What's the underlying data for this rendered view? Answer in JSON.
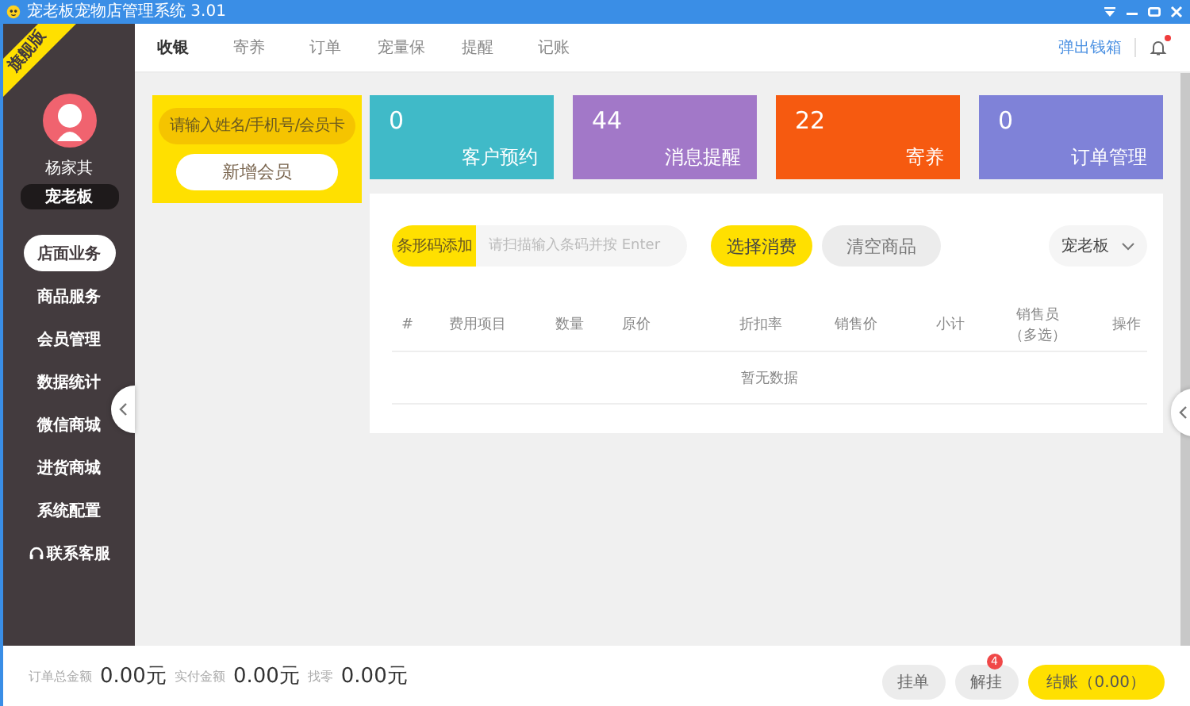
{
  "window": {
    "title": "宠老板宠物店管理系统 3.01"
  },
  "sidebar": {
    "edition_ribbon": "旗舰版",
    "user_name": "杨家其",
    "role": "宠老板",
    "items": [
      {
        "label": "店面业务",
        "selected": true,
        "kind": "menu"
      },
      {
        "label": "商品服务",
        "selected": false,
        "kind": "menu"
      },
      {
        "label": "会员管理",
        "selected": false,
        "kind": "menu"
      },
      {
        "label": "数据统计",
        "selected": false,
        "kind": "menu"
      },
      {
        "label": "微信商城",
        "selected": false,
        "kind": "menu"
      },
      {
        "label": "进货商城",
        "selected": false,
        "kind": "menu"
      },
      {
        "label": "系统配置",
        "selected": false,
        "kind": "menu"
      },
      {
        "label": "联系客服",
        "selected": false,
        "kind": "support"
      }
    ]
  },
  "tabs": [
    {
      "label": "收银",
      "selected": true
    },
    {
      "label": "寄养",
      "selected": false
    },
    {
      "label": "订单",
      "selected": false
    },
    {
      "label": "宠量保",
      "selected": false
    },
    {
      "label": "提醒",
      "selected": false
    },
    {
      "label": "记账",
      "selected": false
    }
  ],
  "header": {
    "cash_drawer_link": "弹出钱箱",
    "unread_notifications": true
  },
  "member": {
    "placeholder": "请输入姓名/手机号/会员卡",
    "add_button": "新增会员"
  },
  "stats": [
    {
      "value": "0",
      "label": "客户预约",
      "color": "#40bac8"
    },
    {
      "value": "44",
      "label": "消息提醒",
      "color": "#a278c8"
    },
    {
      "value": "22",
      "label": "寄养",
      "color": "#f65a10"
    },
    {
      "value": "0",
      "label": "订单管理",
      "color": "#7f82d8"
    }
  ],
  "order": {
    "barcode_label": "条形码添加",
    "barcode_placeholder": "请扫描输入条码并按 Enter",
    "select_button": "选择消费",
    "clear_button": "清空商品",
    "staff_select": "宠老板"
  },
  "table": {
    "columns": [
      {
        "label": "#"
      },
      {
        "label": "费用项目"
      },
      {
        "label": "数量"
      },
      {
        "label": "原价"
      },
      {
        "label": "折扣率"
      },
      {
        "label": "销售价"
      },
      {
        "label": "小计"
      },
      {
        "label": "销售员",
        "note": "（多选）"
      },
      {
        "label": "操作"
      }
    ],
    "empty_text": "暂无数据"
  },
  "summary": [
    {
      "label": "订单总金额",
      "value": "0.00元"
    },
    {
      "label": "实付金额",
      "value": "0.00元"
    },
    {
      "label": "找零",
      "value": "0.00元"
    }
  ],
  "footer_buttons": [
    {
      "label": "挂单",
      "kind": "plain"
    },
    {
      "label": "解挂",
      "kind": "plain",
      "badge": "4"
    },
    {
      "label": "结账（0.00）",
      "kind": "primary"
    }
  ]
}
